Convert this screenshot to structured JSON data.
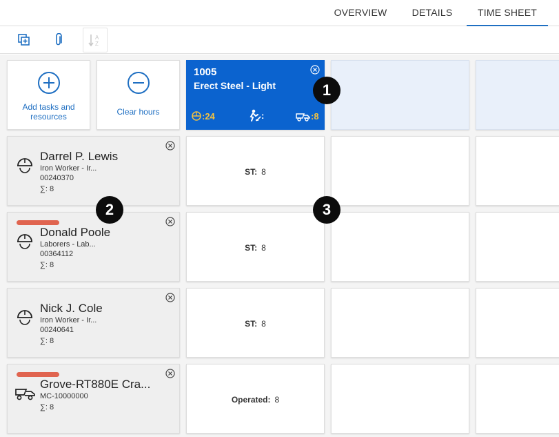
{
  "tabs": [
    {
      "label": "OVERVIEW",
      "active": false
    },
    {
      "label": "DETAILS",
      "active": false
    },
    {
      "label": "TIME SHEET",
      "active": true
    }
  ],
  "toolbar": {
    "icons": [
      "add-copy-icon",
      "attachment-icon",
      "sort-az-icon"
    ]
  },
  "actions": {
    "add_label": "Add tasks and resources",
    "clear_label": "Clear hours"
  },
  "task": {
    "number": "1005",
    "name": "Erect Steel - Light",
    "workers_count": ":24",
    "labor_value": ":",
    "equipment_count": ":8",
    "color": "#0b63cf"
  },
  "resources": [
    {
      "name": "Darrel P. Lewis",
      "role": "Iron Worker - Ir...",
      "id": "00240370",
      "sum": "∑: 8",
      "flag": false,
      "type": "worker",
      "hour_key": "ST:",
      "hour_value": "8"
    },
    {
      "name": "Donald Poole",
      "role": "Laborers - Lab...",
      "id": "00364112",
      "sum": "∑: 8",
      "flag": true,
      "type": "worker",
      "hour_key": "ST:",
      "hour_value": "8"
    },
    {
      "name": "Nick J. Cole",
      "role": "Iron Worker - Ir...",
      "id": "00240641",
      "sum": "∑: 8",
      "flag": false,
      "type": "worker",
      "hour_key": "ST:",
      "hour_value": "8"
    },
    {
      "name": "Grove-RT880E Cra...",
      "role": "",
      "id": "MC-10000000",
      "sum": "∑: 8",
      "flag": true,
      "type": "equipment",
      "hour_key": "Operated:",
      "hour_value": "8"
    }
  ],
  "markers": [
    "1",
    "2",
    "3"
  ],
  "colors": {
    "accent": "#1f6fc2",
    "flag": "#e0644f",
    "highlight": "#f6c23e"
  }
}
